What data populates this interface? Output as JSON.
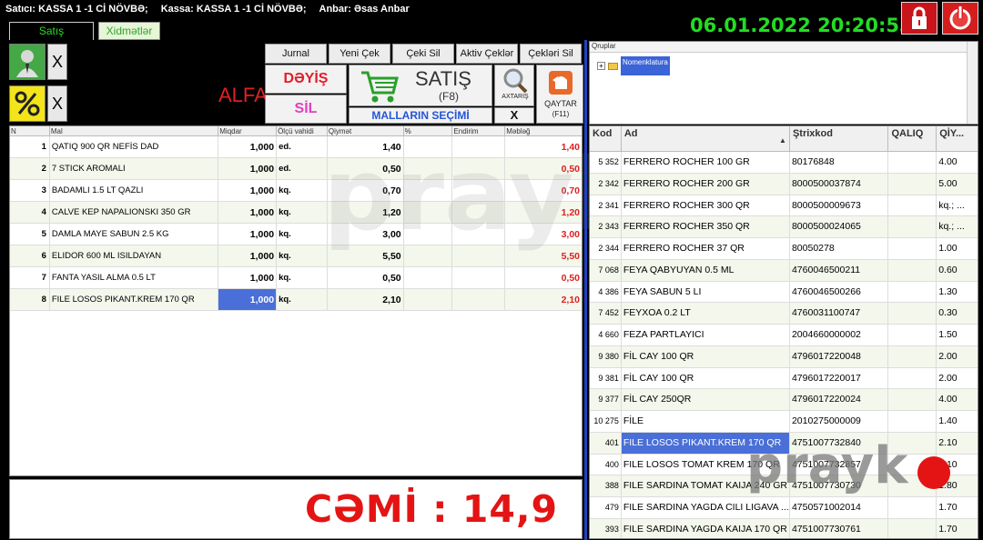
{
  "header": {
    "cashier_label": "Satıcı: KASSA 1 -1 Cİ NÖVBƏ;",
    "register_label": "Kassa: KASSA 1 -1 Cİ NÖVBƏ;",
    "warehouse_label": "Anbar: Əsas Anbar",
    "datetime": "06.01.2022 20:20:53"
  },
  "tabs": [
    {
      "label": "Satış"
    },
    {
      "label": "Xidmətlər"
    }
  ],
  "toolbar": {
    "x_label": "X",
    "customer_text": "ALFA",
    "journal": "Jurnal",
    "new_check": "Yeni Çek",
    "delete_check": "Çeki Sil",
    "active_checks": "Aktiv Çeklər",
    "delete_checks": "Çekləri Sil",
    "change": "DƏYİŞ",
    "delete": "SİL",
    "sale": "SATIŞ",
    "sale_key": "(F8)",
    "search": "AXTARIŞ",
    "return": "QAYTAR",
    "return_key": "(F11)",
    "goods_selection": "MALLARIN SEÇİMİ",
    "close": "X"
  },
  "sale_table": {
    "columns": [
      "N",
      "Mal",
      "Miqdar",
      "Ölçü vahidi",
      "Qiymət",
      "%",
      "Endirim",
      "Məbləğ"
    ],
    "rows": [
      {
        "n": "1",
        "mal": "QATIQ 900 QR NEFİS DAD",
        "miqdar": "1,000",
        "olcu": "ed.",
        "qiymet": "1,40",
        "pct": "",
        "endirim": "",
        "mebleg": "1,40"
      },
      {
        "n": "2",
        "mal": "7 STICK AROMALI",
        "miqdar": "1,000",
        "olcu": "ed.",
        "qiymet": "0,50",
        "pct": "",
        "endirim": "",
        "mebleg": "0,50"
      },
      {
        "n": "3",
        "mal": "BADAMLI 1.5 LT QAZLI",
        "miqdar": "1,000",
        "olcu": "kq.",
        "qiymet": "0,70",
        "pct": "",
        "endirim": "",
        "mebleg": "0,70"
      },
      {
        "n": "4",
        "mal": "CALVE  KEP NAPALIONSKI 350 GR",
        "miqdar": "1,000",
        "olcu": "kq.",
        "qiymet": "1,20",
        "pct": "",
        "endirim": "",
        "mebleg": "1,20"
      },
      {
        "n": "5",
        "mal": "DAMLA MAYE SABUN 2.5 KG",
        "miqdar": "1,000",
        "olcu": "kq.",
        "qiymet": "3,00",
        "pct": "",
        "endirim": "",
        "mebleg": "3,00"
      },
      {
        "n": "6",
        "mal": "ELIDOR 600 ML ISILDAYAN",
        "miqdar": "1,000",
        "olcu": "kq.",
        "qiymet": "5,50",
        "pct": "",
        "endirim": "",
        "mebleg": "5,50"
      },
      {
        "n": "7",
        "mal": "FANTA YASIL ALMA 0.5 LT",
        "miqdar": "1,000",
        "olcu": "kq.",
        "qiymet": "0,50",
        "pct": "",
        "endirim": "",
        "mebleg": "0,50"
      },
      {
        "n": "8",
        "mal": "FILE LOSOS PIKANT.KREM 170 QR",
        "miqdar": "1,000",
        "olcu": "kq.",
        "qiymet": "2,10",
        "pct": "",
        "endirim": "",
        "mebleg": "2,10"
      }
    ]
  },
  "total": {
    "text": "CƏMİ :  14,9"
  },
  "groups": {
    "title": "Qruplar",
    "node": "Nomenklatura"
  },
  "products_table": {
    "columns": [
      "Kod",
      "Ad",
      "Ştrixkod",
      "QALIQ",
      "QİY..."
    ],
    "rows": [
      {
        "kod": "5 352",
        "ad": "FERRERO ROCHER 100 GR",
        "strix": "80176848",
        "qaliq": "",
        "qiy": "4.00"
      },
      {
        "kod": "2 342",
        "ad": "FERRERO ROCHER 200 GR",
        "strix": "8000500037874",
        "qaliq": "",
        "qiy": "5.00"
      },
      {
        "kod": "2 341",
        "ad": "FERRERO ROCHER 300 QR",
        "strix": "8000500009673",
        "qaliq": "",
        "qiy": "kq.; ..."
      },
      {
        "kod": "2 343",
        "ad": "FERRERO ROCHER 350 QR",
        "strix": "8000500024065",
        "qaliq": "",
        "qiy": "kq.; ..."
      },
      {
        "kod": "2 344",
        "ad": "FERRERO ROCHER 37 QR",
        "strix": "80050278",
        "qaliq": "",
        "qiy": "1.00"
      },
      {
        "kod": "7 068",
        "ad": "FEYA QABYUYAN 0.5 ML",
        "strix": "4760046500211",
        "qaliq": "",
        "qiy": "0.60"
      },
      {
        "kod": "4 386",
        "ad": "FEYA SABUN 5 LI",
        "strix": "4760046500266",
        "qaliq": "",
        "qiy": "1.30"
      },
      {
        "kod": "7 452",
        "ad": "FEYXOA 0.2 LT",
        "strix": "4760031100747",
        "qaliq": "",
        "qiy": "0.30"
      },
      {
        "kod": "4 660",
        "ad": "FEZA PARTLAYICI",
        "strix": "2004660000002",
        "qaliq": "",
        "qiy": "1.50"
      },
      {
        "kod": "9 380",
        "ad": "FİL CAY 100 QR",
        "strix": "4796017220048",
        "qaliq": "",
        "qiy": "2.00"
      },
      {
        "kod": "9 381",
        "ad": "FİL CAY 100 QR",
        "strix": "4796017220017",
        "qaliq": "",
        "qiy": "2.00"
      },
      {
        "kod": "9 377",
        "ad": "FİL CAY 250QR",
        "strix": "4796017220024",
        "qaliq": "",
        "qiy": "4.00"
      },
      {
        "kod": "10 275",
        "ad": "FİLE",
        "strix": "2010275000009",
        "qaliq": "",
        "qiy": "1.40"
      },
      {
        "kod": "401",
        "ad": "FILE LOSOS PIKANT.KREM 170 QR",
        "strix": "4751007732840",
        "qaliq": "",
        "qiy": "2.10"
      },
      {
        "kod": "400",
        "ad": "FILE LOSOS TOMAT KREM 170 QR",
        "strix": "4751007732857",
        "qaliq": "",
        "qiy": "2.10"
      },
      {
        "kod": "388",
        "ad": "FILE SARDINA TOMAT KAIJA 240 GR",
        "strix": "4751007730730",
        "qaliq": "",
        "qiy": "1.80"
      },
      {
        "kod": "479",
        "ad": "FILE SARDINA YAGDA CILI LIGAVA ...",
        "strix": "4750571002014",
        "qaliq": "",
        "qiy": "1.70"
      },
      {
        "kod": "393",
        "ad": "FILE SARDINA YAGDA KAIJA 170 QR",
        "strix": "4751007730761",
        "qaliq": "",
        "qiy": "1.70"
      }
    ]
  },
  "watermark": {
    "text": "prayk"
  },
  "colors": {
    "clock": "#22dd22",
    "total": "#e41414",
    "selection": "#4a6fd8",
    "divider": "#2042c0"
  }
}
